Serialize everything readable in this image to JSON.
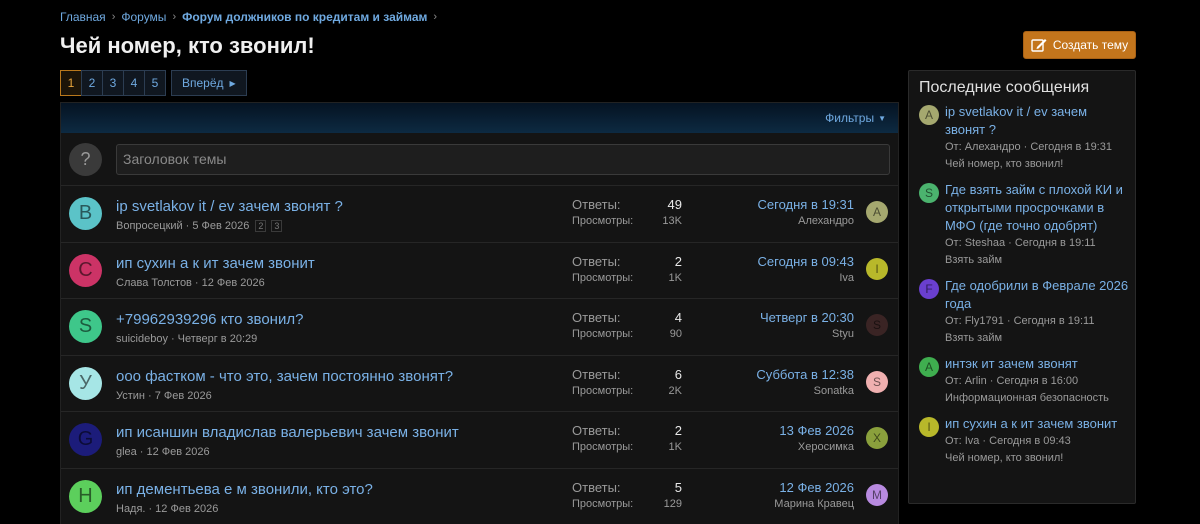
{
  "breadcrumb": {
    "home": "Главная",
    "forums": "Форумы",
    "current": "Форум должников по кредитам и займам"
  },
  "page": {
    "title": "Чей номер, кто звонил!",
    "create_label": "Создать тему"
  },
  "pager": {
    "pages": [
      "1",
      "2",
      "3",
      "4",
      "5"
    ],
    "active": "1",
    "next_label": "Вперёд"
  },
  "list": {
    "filters_label": "Фильтры",
    "quick_placeholder": "Заголовок темы",
    "quick_icon": "?",
    "threads": [
      {
        "avatar": "B",
        "avatar_color": "#5bc3c8",
        "title": "ip svetlakov it / ev зачем звонят ?",
        "author": "Вопросецкий",
        "date": "5 Фев 2026",
        "pages": [
          "2",
          "3"
        ],
        "replies_label": "Ответы:",
        "replies": "49",
        "views_label": "Просмотры:",
        "views": "13K",
        "last_date": "Сегодня в 19:31",
        "last_user": "Алехандро",
        "last_avatar": "A",
        "last_avatar_color": "#a5a86f"
      },
      {
        "avatar": "C",
        "avatar_color": "#cc3366",
        "title": "ип сухин а к ит зачем звонит",
        "author": "Слава Толстов",
        "date": "12 Фев 2026",
        "pages": [],
        "replies_label": "Ответы:",
        "replies": "2",
        "views_label": "Просмотры:",
        "views": "1K",
        "last_date": "Сегодня в 09:43",
        "last_user": "Iva",
        "last_avatar": "I",
        "last_avatar_color": "#b8b82a"
      },
      {
        "avatar": "S",
        "avatar_color": "#3ec78a",
        "title": "+79962939296 кто звонил?",
        "author": "suicideboy",
        "date": "Четверг в 20:29",
        "pages": [],
        "replies_label": "Ответы:",
        "replies": "4",
        "views_label": "Просмотры:",
        "views": "90",
        "last_date": "Четверг в 20:30",
        "last_user": "Styu",
        "last_avatar": "S",
        "last_avatar_color": "#3a2424"
      },
      {
        "avatar": "У",
        "avatar_color": "#a6e6e6",
        "title": "ооо фастком - что это, зачем постоянно звонят?",
        "author": "Устин",
        "date": "7 Фев 2026",
        "pages": [],
        "replies_label": "Ответы:",
        "replies": "6",
        "views_label": "Просмотры:",
        "views": "2K",
        "last_date": "Суббота в 12:38",
        "last_user": "Sonatka",
        "last_avatar": "S",
        "last_avatar_color": "#f0b0b0"
      },
      {
        "avatar": "G",
        "avatar_color": "#1c1c7a",
        "title": "ип исаншин владислав валерьевич зачем звонит",
        "author": "glea",
        "date": "12 Фев 2026",
        "pages": [],
        "replies_label": "Ответы:",
        "replies": "2",
        "views_label": "Просмотры:",
        "views": "1K",
        "last_date": "13 Фев 2026",
        "last_user": "Херосимка",
        "last_avatar": "X",
        "last_avatar_color": "#8aa03c"
      },
      {
        "avatar": "Н",
        "avatar_color": "#5ccf5c",
        "title": "ип дементьева е м звонили, кто это?",
        "author": "Надя.",
        "date": "12 Фев 2026",
        "pages": [],
        "replies_label": "Ответы:",
        "replies": "5",
        "views_label": "Просмотры:",
        "views": "129",
        "last_date": "12 Фев 2026",
        "last_user": "Марина Кравец",
        "last_avatar": "M",
        "last_avatar_color": "#b88ae0"
      }
    ]
  },
  "sidebar": {
    "title": "Последние сообщения",
    "items": [
      {
        "avatar": "A",
        "avatar_color": "#a5a86f",
        "title": "ip svetlakov it / ev зачем звонят ?",
        "by": "От: Алехандро · Сегодня в 19:31",
        "forum": "Чей номер, кто звонил!"
      },
      {
        "avatar": "S",
        "avatar_color": "#4bb36e",
        "title": "Где взять займ с плохой КИ и открытыми просрочками в МФО (где точно одобрят)",
        "by": "От: Steshaa · Сегодня в 19:11",
        "forum": "Взять займ"
      },
      {
        "avatar": "F",
        "avatar_color": "#6a3fcf",
        "title": "Где одобрили в Феврале 2026 года",
        "by": "От: Fly1791 · Сегодня в 19:11",
        "forum": "Взять займ"
      },
      {
        "avatar": "A",
        "avatar_color": "#3fae4f",
        "title": "интэк ит зачем звонят",
        "by": "От: Arlin · Сегодня в 16:00",
        "forum": "Информационная безопасность"
      },
      {
        "avatar": "I",
        "avatar_color": "#b8b82a",
        "title": "ип сухин а к ит зачем звонит",
        "by": "От: Iva · Сегодня в 09:43",
        "forum": "Чей номер, кто звонил!"
      }
    ]
  },
  "colors": {
    "accent": "#c3751c",
    "link": "#7ab1e6",
    "background": "#000000"
  }
}
